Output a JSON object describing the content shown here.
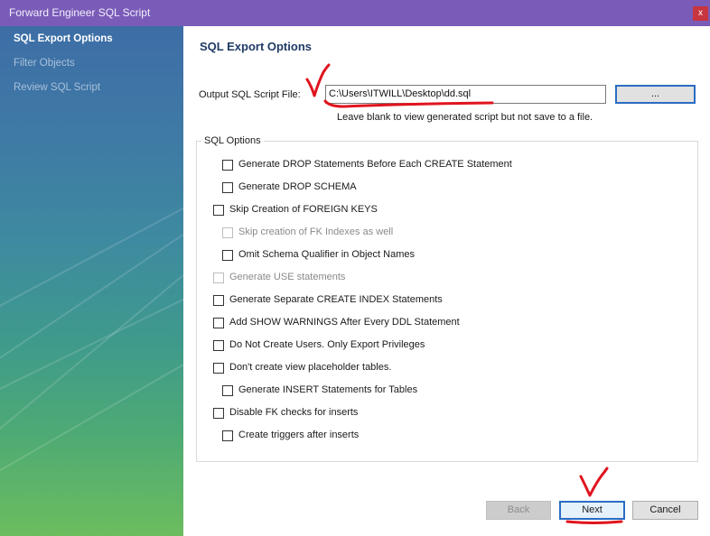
{
  "window": {
    "title": "Forward Engineer SQL Script",
    "close_label": "x"
  },
  "sidebar": {
    "items": [
      {
        "label": "SQL Export Options",
        "state": "active"
      },
      {
        "label": "Filter Objects",
        "state": "inactive"
      },
      {
        "label": "Review SQL Script",
        "state": "inactive"
      }
    ]
  },
  "main": {
    "title": "SQL Export Options",
    "output_label": "Output SQL Script File:",
    "output_value": "C:\\Users\\ITWILL\\Desktop\\dd.sql",
    "browse_label": "...",
    "hint": "Leave blank to view generated script but not save to a file.",
    "options_legend": "SQL Options",
    "options": [
      {
        "label": "Generate DROP Statements Before Each CREATE Statement",
        "checked": false,
        "enabled": true
      },
      {
        "label": "Generate DROP SCHEMA",
        "checked": false,
        "enabled": true
      },
      {
        "label": "Skip Creation of FOREIGN KEYS",
        "checked": false,
        "enabled": true
      },
      {
        "label": "Skip creation of FK Indexes as well",
        "checked": false,
        "enabled": false
      },
      {
        "label": "Omit Schema Qualifier in Object Names",
        "checked": false,
        "enabled": true
      },
      {
        "label": "Generate USE statements",
        "checked": false,
        "enabled": false
      },
      {
        "label": "Generate Separate CREATE INDEX Statements",
        "checked": false,
        "enabled": true
      },
      {
        "label": "Add SHOW WARNINGS After Every DDL Statement",
        "checked": false,
        "enabled": true
      },
      {
        "label": "Do Not Create Users. Only Export Privileges",
        "checked": false,
        "enabled": true
      },
      {
        "label": "Don't create view placeholder tables.",
        "checked": false,
        "enabled": true
      },
      {
        "label": "Generate INSERT Statements for Tables",
        "checked": false,
        "enabled": true
      },
      {
        "label": "Disable FK checks for inserts",
        "checked": false,
        "enabled": true
      },
      {
        "label": "Create triggers after inserts",
        "checked": false,
        "enabled": true
      }
    ]
  },
  "footer": {
    "back_label": "Back",
    "next_label": "Next",
    "cancel_label": "Cancel"
  },
  "colors": {
    "titlebar": "#7a5cb8",
    "accent_border": "#2b6cc4",
    "annotation": "#e0141e"
  }
}
